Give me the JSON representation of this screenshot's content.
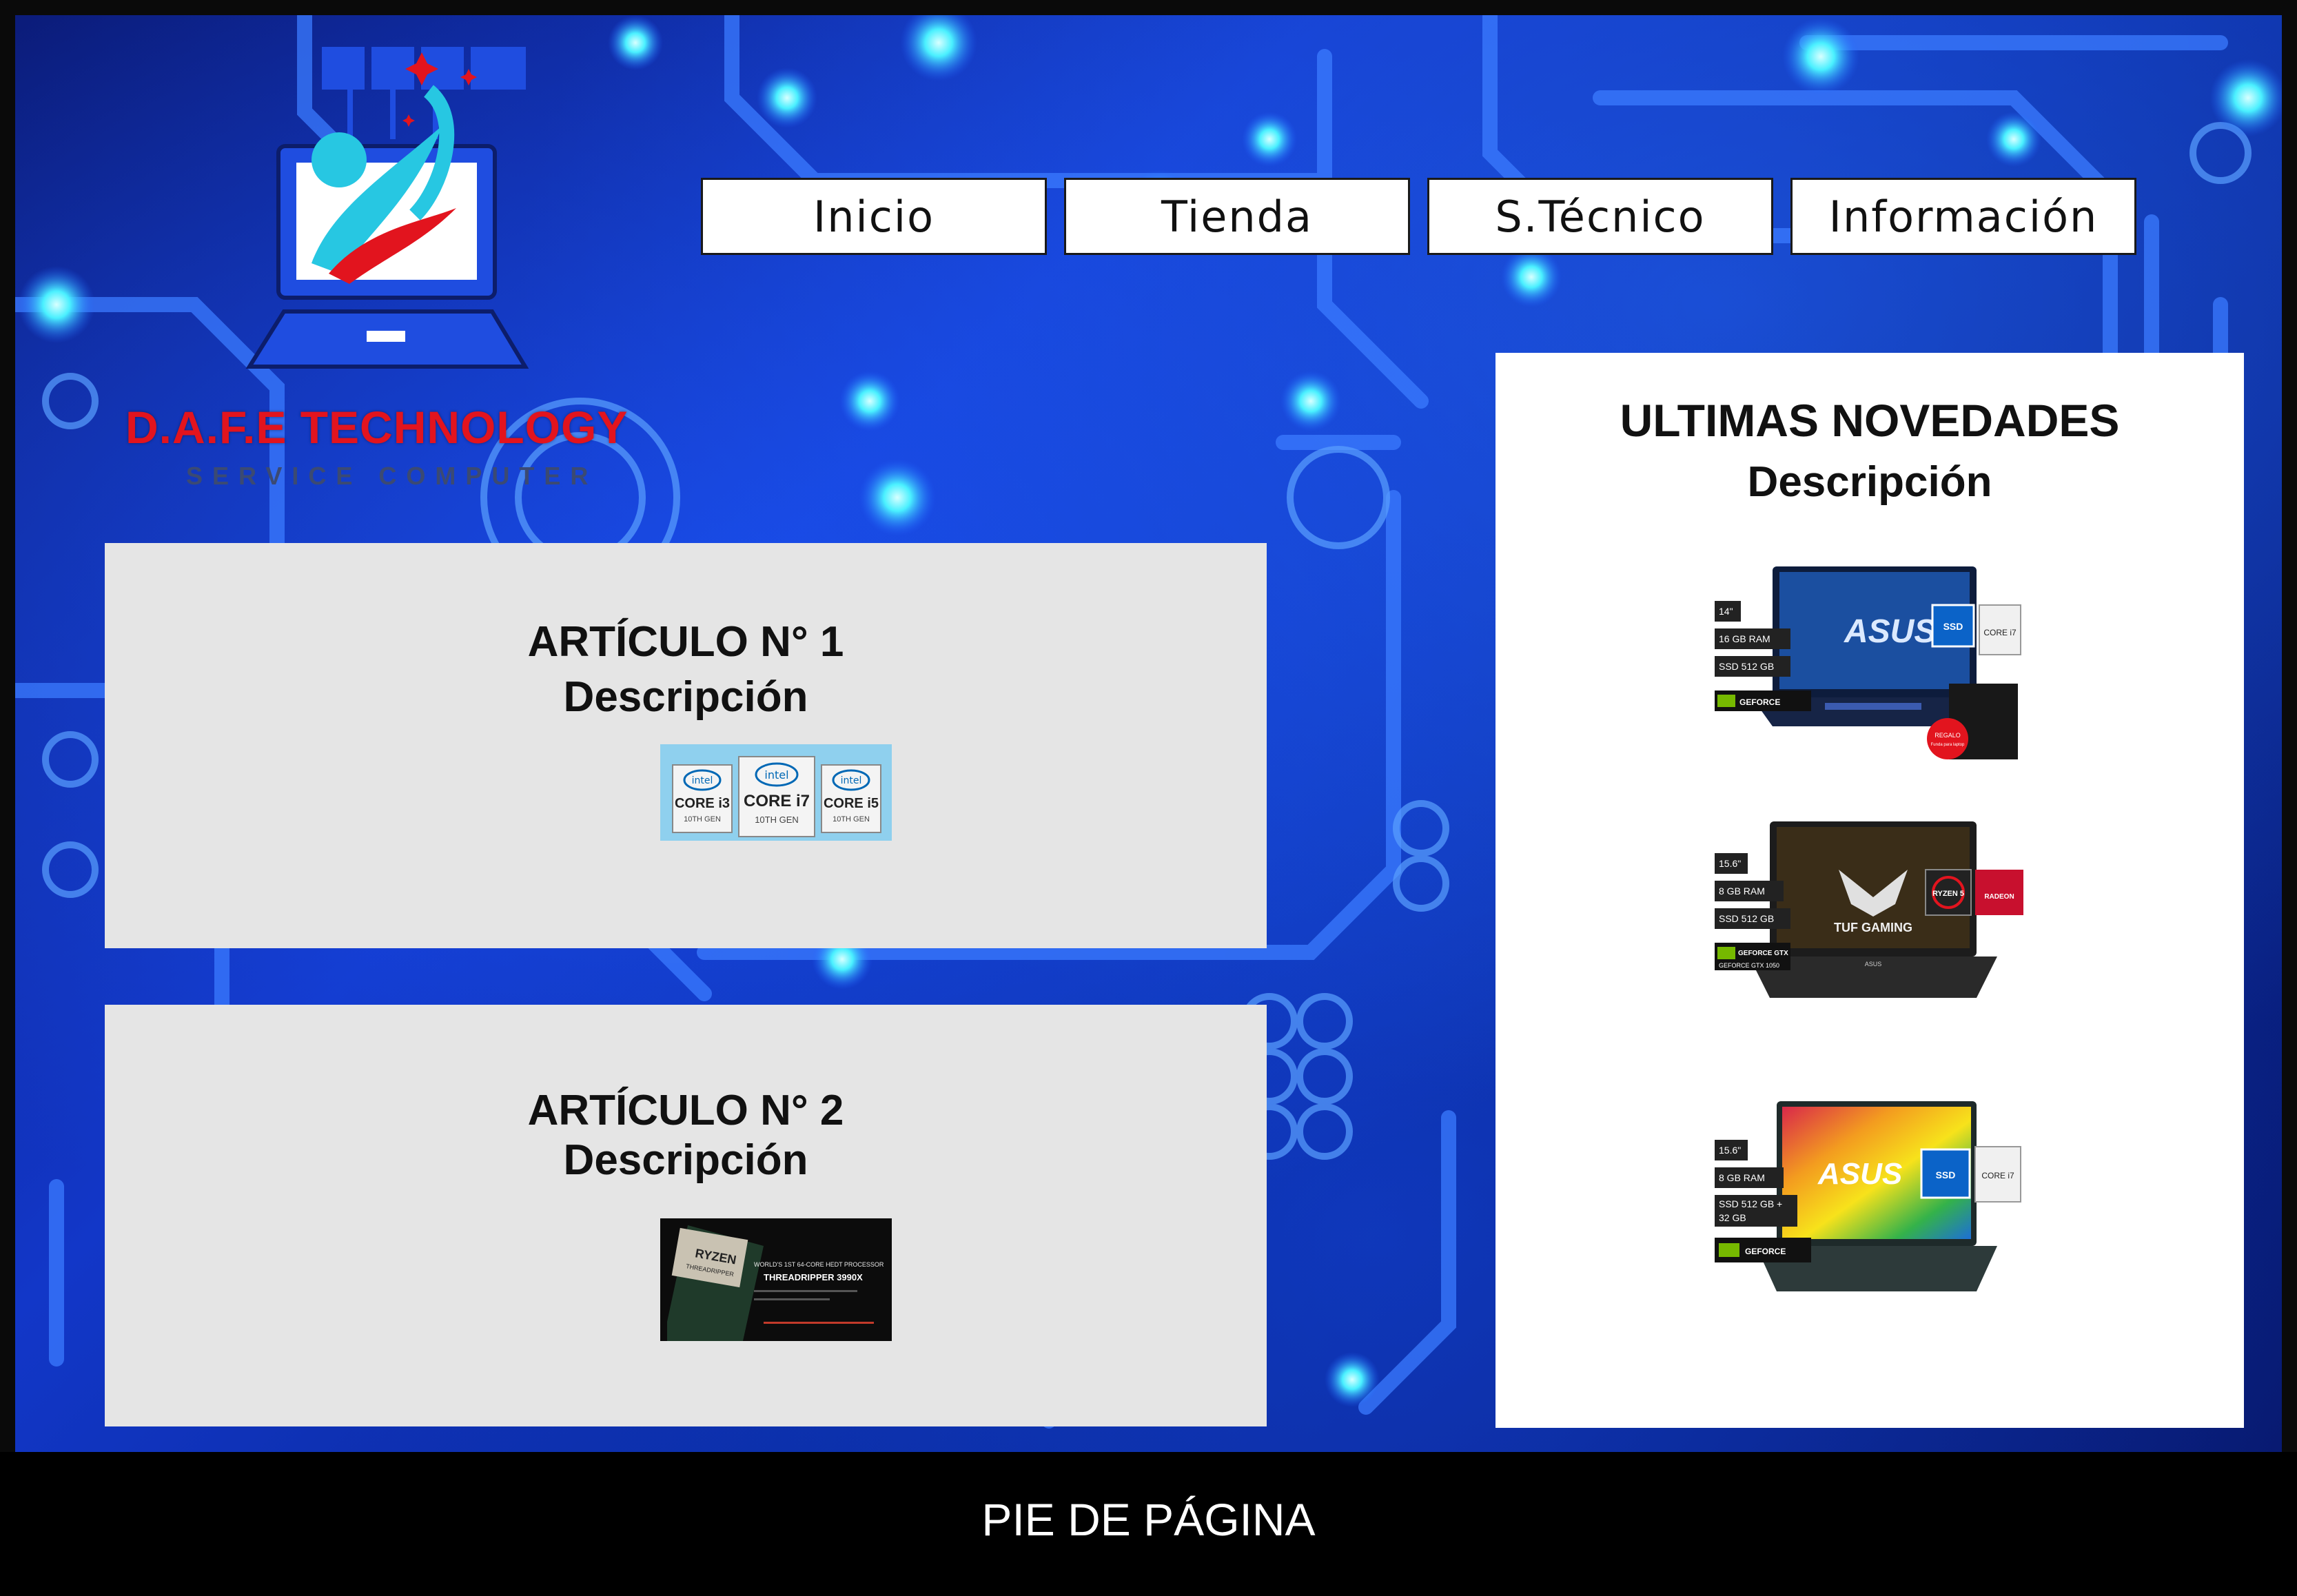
{
  "brand": {
    "name": "D.A.F.E TECHNOLOGY",
    "tagline": "SERVICE COMPUTER",
    "logo_icon": "laptop-logo-icon",
    "colors": {
      "red": "#e2141e",
      "blue": "#1f4de0",
      "cyan": "#2bd0e8"
    }
  },
  "nav": {
    "items": [
      {
        "label": "Inicio"
      },
      {
        "label": "Tienda"
      },
      {
        "label": "S.Técnico"
      },
      {
        "label": "Información"
      }
    ]
  },
  "articles": [
    {
      "title": "ARTÍCULO N° 1",
      "description": "Descripción",
      "image": "intel-core-badges"
    },
    {
      "title": "ARTÍCULO N° 2",
      "description": "Descripción",
      "image": "amd-threadripper-banner"
    }
  ],
  "intel_badges": {
    "items": [
      {
        "brand": "intel",
        "line1": "CORE i3",
        "line2": "10TH GEN"
      },
      {
        "brand": "intel",
        "line1": "CORE i7",
        "line2": "10TH GEN"
      },
      {
        "brand": "intel",
        "line1": "CORE i5",
        "line2": "10TH GEN"
      }
    ]
  },
  "threadripper": {
    "chip": "RYZEN",
    "chip_sub": "THREADRIPPER",
    "headline": "WORLD'S 1ST 64-CORE HEDT PROCESSOR",
    "model": "THREADRIPPER 3990X"
  },
  "novedades": {
    "title": "ULTIMAS NOVEDADES",
    "description": "Descripción",
    "laptops": [
      {
        "brand": "ASUS",
        "specs": [
          "14\"",
          "16 GB RAM",
          "SSD 512 GB"
        ],
        "gpu": "GEFORCE",
        "badges": [
          "SSD",
          "CORE i7"
        ],
        "extra": [
          "REGALO",
          "Funda para laptop"
        ]
      },
      {
        "brand": "ASUS",
        "screen_text": "TUF GAMING",
        "specs": [
          "15.6\"",
          "8 GB RAM",
          "SSD 512 GB"
        ],
        "gpu": "GEFORCE GTX",
        "gpu_model": "GEFORCE GTX 1050",
        "badges": [
          "RYZEN 5",
          "RADEON"
        ]
      },
      {
        "brand": "ASUS",
        "specs": [
          "15.6\"",
          "8 GB RAM",
          "SSD 512 GB +",
          "32 GB"
        ],
        "gpu": "GEFORCE",
        "badges": [
          "SSD",
          "CORE i7"
        ]
      }
    ]
  },
  "footer": {
    "text": "PIE DE PÁGINA"
  }
}
